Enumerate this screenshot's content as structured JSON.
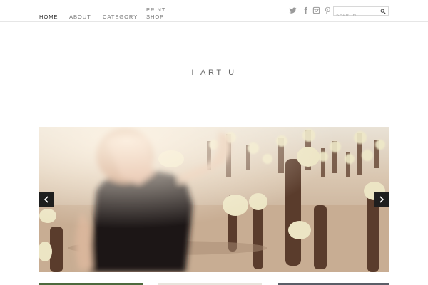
{
  "nav": {
    "items": [
      {
        "label": "HOME"
      },
      {
        "label": "ABOUT"
      },
      {
        "label": "CATEGORY"
      },
      {
        "label": "PRINT SHOP"
      }
    ]
  },
  "social": {
    "icons": [
      "twitter-icon",
      "facebook-icon",
      "instagram-icon",
      "pinterest-icon"
    ]
  },
  "search": {
    "placeholder": "SEARCH",
    "value": ""
  },
  "site": {
    "title": "I ART U"
  },
  "slider": {
    "prev_icon": "chevron-left-icon",
    "next_icon": "chevron-right-icon"
  },
  "colors": {
    "nav_text": "#777777",
    "active_nav": "#333333",
    "arrow_bg": "#1e1e1e",
    "border": "#e6e6e6"
  }
}
